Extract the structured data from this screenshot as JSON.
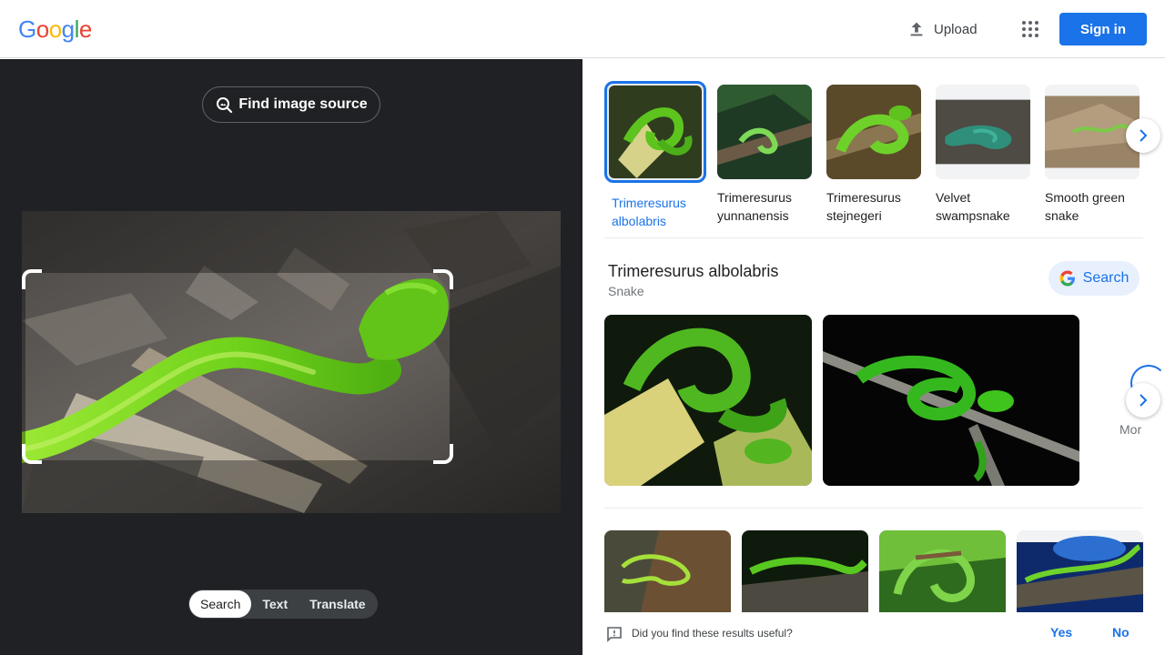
{
  "header": {
    "logo_letters": [
      {
        "ch": "G",
        "color": "#4285F4"
      },
      {
        "ch": "o",
        "color": "#EA4335"
      },
      {
        "ch": "o",
        "color": "#FBBC05"
      },
      {
        "ch": "g",
        "color": "#4285F4"
      },
      {
        "ch": "l",
        "color": "#34A853"
      },
      {
        "ch": "e",
        "color": "#EA4335"
      }
    ],
    "upload_label": "Upload",
    "upload_icon": "upload-icon",
    "apps_icon": "apps-grid-icon",
    "signin_label": "Sign in",
    "signin_color": "#1a73e8"
  },
  "left": {
    "find_source_label": "Find image source",
    "find_source_icon": "image-search-icon",
    "modes": [
      "Search",
      "Text",
      "Translate"
    ],
    "active_mode": "Search",
    "background": "#202124"
  },
  "results": {
    "entities": [
      {
        "name": "Trimeresurus albolabris",
        "selected": true
      },
      {
        "name": "Trimeresurus yunnanensis",
        "selected": false
      },
      {
        "name": "Trimeresurus stejnegeri",
        "selected": false
      },
      {
        "name": "Velvet swampsnake",
        "selected": false
      },
      {
        "name": "Smooth green snake",
        "selected": false
      }
    ],
    "knowledge": {
      "title": "Trimeresurus albolabris",
      "subtitle": "Snake",
      "search_label": "Search",
      "more_label": "Mor"
    },
    "feedback": {
      "question": "Did you find these results useful?",
      "yes": "Yes",
      "no": "No"
    },
    "accent": "#1a73e8"
  }
}
